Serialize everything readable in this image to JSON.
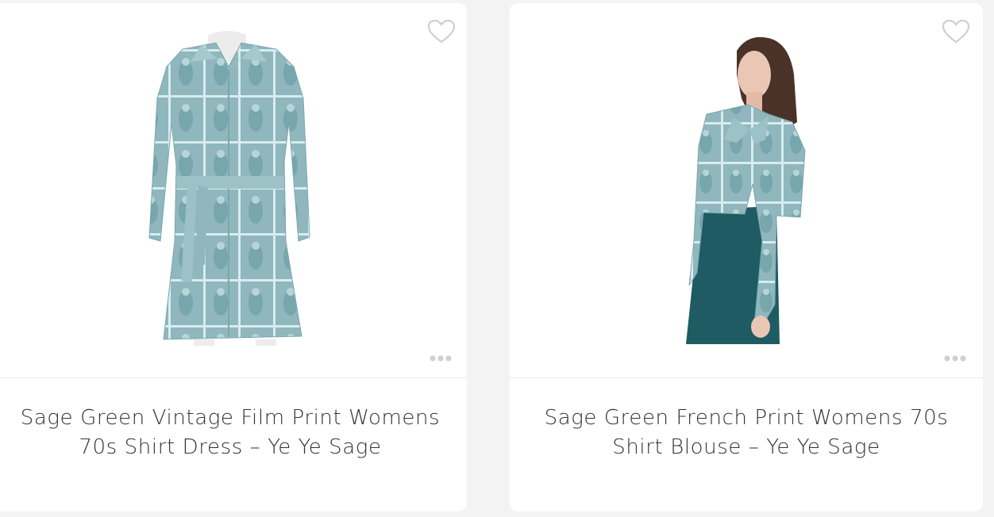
{
  "products": [
    {
      "title": "Sage Green Vintage Film Print Womens 70s Shirt Dress – Ye Ye Sage",
      "image_subject": "shirt dress on mannequin",
      "wishlist_icon": "heart-outline-icon",
      "more_icon": "more-dots-icon"
    },
    {
      "title": "Sage Green French Print Womens 70s Shirt Blouse – Ye Ye Sage",
      "image_subject": "model wearing blouse",
      "wishlist_icon": "heart-outline-icon",
      "more_icon": "more-dots-icon"
    }
  ],
  "colors": {
    "background": "#f3f3f3",
    "card": "#ffffff",
    "print": "#8fb7bd",
    "print_dark": "#5f8f98",
    "trousers": "#1f5b62",
    "text": "#333333",
    "icon": "#cfcfcf"
  }
}
